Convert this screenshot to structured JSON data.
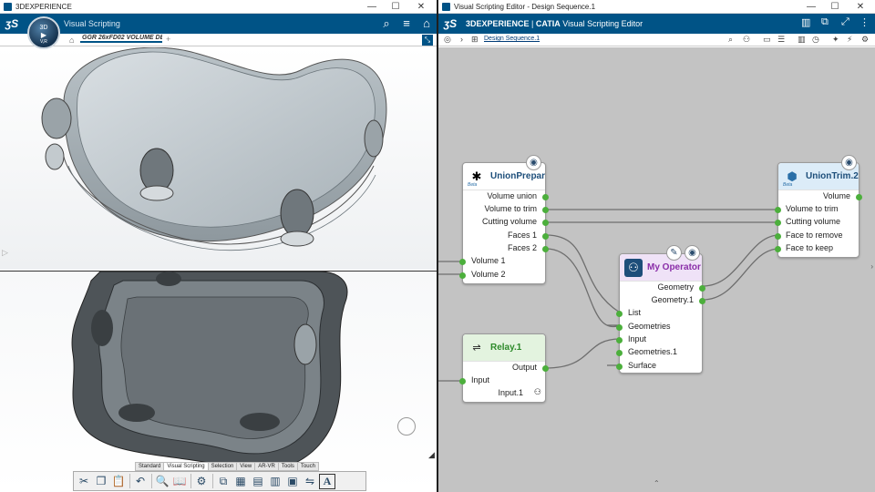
{
  "left_window": {
    "title": "3DEXPERIENCE",
    "app_name": "Visual Scripting",
    "compass_label": "3D",
    "compass_version": "V,R",
    "tab_label": "GGR 26xFD02 VOLUME DE",
    "command_tabs": [
      "Standard",
      "Visual Scripting",
      "Selection",
      "View",
      "AR-VR",
      "Tools",
      "Touch"
    ],
    "active_command_tab": "Visual Scripting"
  },
  "right_window": {
    "title": "Visual Scripting Editor - Design Sequence.1",
    "brand_prefix": "3DEXPERIENCE",
    "brand_app": "CATIA",
    "brand_suffix": "Visual Scripting Editor",
    "breadcrumb": "Design Sequence.1"
  },
  "nodes": {
    "union_prepare": {
      "title": "UnionPrepar",
      "beta": "Beta",
      "outputs": [
        "Volume union",
        "Volume to trim",
        "Cutting volume",
        "Faces 1",
        "Faces 2"
      ],
      "inputs": [
        "Volume 1",
        "Volume 2"
      ]
    },
    "union_trim": {
      "title": "UnionTrim.2",
      "beta": "Beta",
      "outputs": [
        "Volume"
      ],
      "inputs": [
        "Volume to trim",
        "Cutting volume",
        "Face to remove",
        "Face to keep"
      ]
    },
    "my_operator": {
      "title": "My Operator",
      "outputs": [
        "Geometry",
        "Geometry.1"
      ],
      "inputs": [
        "List",
        "Geometries",
        "Input",
        "Geometries.1",
        "Surface"
      ]
    },
    "relay": {
      "title": "Relay.1",
      "outputs": [
        "Output"
      ],
      "inputs": [
        "Input"
      ],
      "extra": "Input.1"
    }
  },
  "colors": {
    "brand_blue": "#005386",
    "port_green": "#4caf3c",
    "canvas_gray": "#c3c3c3",
    "operator_header": "#efe2f7",
    "relay_header": "#e3f3df",
    "trim_header": "#dcecf8"
  }
}
